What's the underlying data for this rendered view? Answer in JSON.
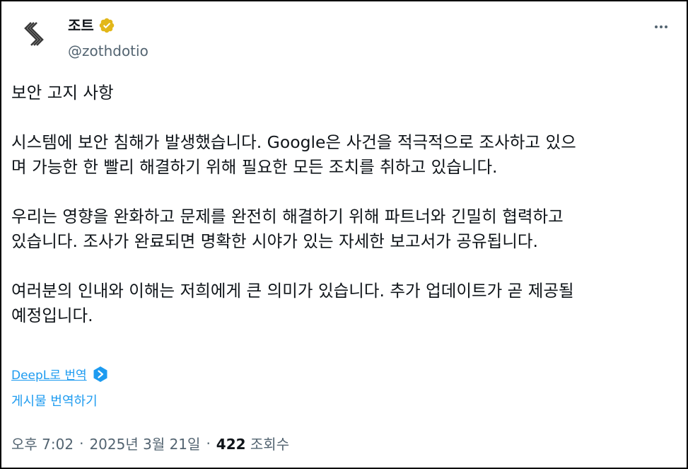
{
  "author": {
    "display_name": "조트",
    "handle": "@zothdotio",
    "verified": true,
    "avatar_icon": "zoth-logo",
    "badge_color": "#e2b719"
  },
  "menu": {
    "more_icon": "more-horizontal-icon"
  },
  "post": {
    "paragraphs": [
      "보안 고지 사항",
      "시스템에 보안 침해가 발생했습니다. Google은 사건을 적극적으로 조사하고 있으\n며 가능한 한 빨리 해결하기 위해 필요한 모든 조치를 취하고 있습니다.",
      "우리는 영향을 완화하고 문제를 완전히 해결하기 위해 파트너와 긴밀히 협력하고\n있습니다. 조사가 완료되면 명확한 시야가 있는 자세한 보고서가 공유됩니다.",
      "여러분의 인내와 이해는 저희에게 큰 의미가 있습니다. 추가 업데이트가 곧 제공될\n예정입니다."
    ]
  },
  "translation": {
    "deepl_label": "DeepL로 번역",
    "deepl_icon": "deepl-icon",
    "translate_post_label": "게시물 번역하기"
  },
  "meta": {
    "time": "오후 7:02",
    "separator": "·",
    "date": "2025년 3월 21일",
    "views_count": "422",
    "views_label": "조회수"
  },
  "colors": {
    "link": "#1d9bf0",
    "secondary_text": "#536471",
    "primary_text": "#0f1419"
  }
}
